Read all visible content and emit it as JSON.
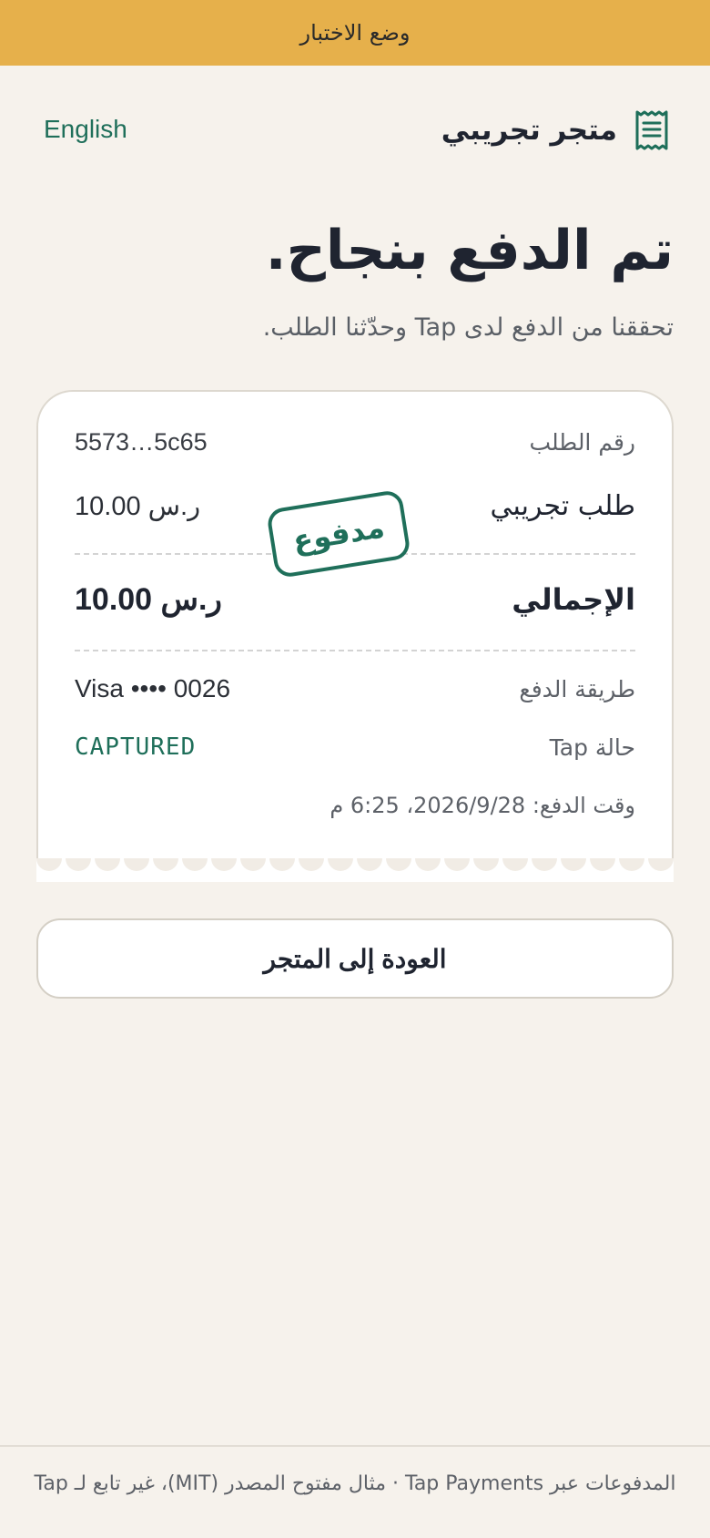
{
  "banner": {
    "text": "وضع الاختبار"
  },
  "header": {
    "language_link": "English",
    "store_name": "متجر تجريبي",
    "store_icon": "receipt-icon"
  },
  "main": {
    "title": "تم الدفع بنجاح.",
    "subtitle": "تحققنا من الدفع لدى Tap وحدّثنا الطلب."
  },
  "receipt": {
    "order_label": "رقم الطلب",
    "order_value": "5573…5c65",
    "item_label": "طلب تجريبي",
    "item_value": "10.00 ر.س",
    "stamp": "مدفوع",
    "total_label": "الإجمالي",
    "total_value": "10.00 ر.س",
    "method_label": "طريقة الدفع",
    "method_value": "Visa •••• 0026",
    "status_label": "حالة Tap",
    "status_value": "CAPTURED",
    "paid_time": "وقت الدفع: 2026/9/28، 6:25 م"
  },
  "actions": {
    "back_button": "العودة إلى المتجر"
  },
  "footer": {
    "text": "المدفوعات عبر Tap Payments · مثال مفتوح المصدر (MIT)، غير تابع لـ Tap"
  },
  "colors": {
    "banner": "#e6b04b",
    "accent": "#1f6f5a",
    "background": "#f6f2ec"
  }
}
